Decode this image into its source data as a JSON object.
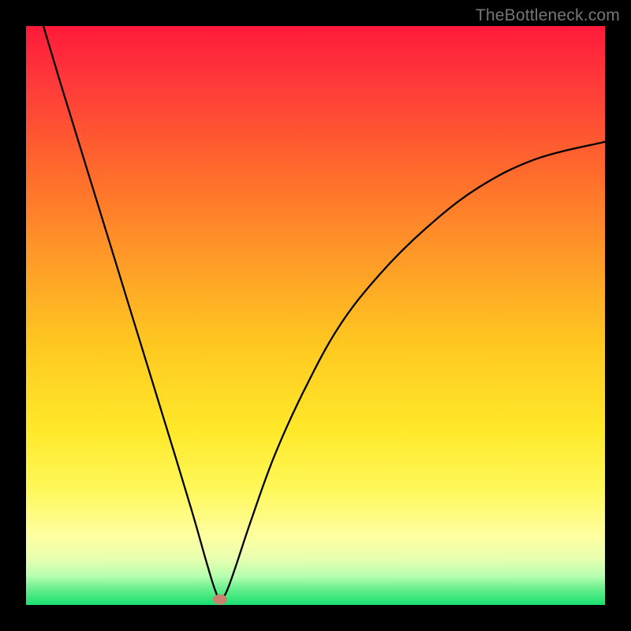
{
  "watermark": {
    "text": "TheBottleneck.com"
  },
  "chart_data": {
    "type": "line",
    "title": "",
    "xlabel": "",
    "ylabel": "",
    "xlim": [
      0,
      100
    ],
    "ylim": [
      0,
      100
    ],
    "grid": false,
    "series": [
      {
        "name": "bottleneck-curve",
        "x": [
          3,
          6,
          10,
          14,
          18,
          22,
          26,
          29,
          31,
          32.5,
          33.5,
          34.5,
          36,
          39,
          43,
          48,
          54,
          61,
          69,
          78,
          88,
          100
        ],
        "y": [
          100,
          90,
          77,
          64,
          51,
          38,
          25,
          15,
          8,
          3,
          1,
          2,
          6,
          15,
          26,
          37,
          48,
          57,
          65,
          72,
          77,
          80
        ]
      }
    ],
    "marker": {
      "x": 33.5,
      "y": 1,
      "color": "#c9836f"
    },
    "background_gradient": {
      "stops": [
        {
          "pos": 0,
          "color": "#ff1a3a"
        },
        {
          "pos": 10,
          "color": "#ff3a3a"
        },
        {
          "pos": 25,
          "color": "#ff6a2c"
        },
        {
          "pos": 40,
          "color": "#ff9a28"
        },
        {
          "pos": 55,
          "color": "#ffc820"
        },
        {
          "pos": 70,
          "color": "#ffe92a"
        },
        {
          "pos": 80,
          "color": "#fff85a"
        },
        {
          "pos": 88,
          "color": "#ffffa0"
        },
        {
          "pos": 92,
          "color": "#e8ffb0"
        },
        {
          "pos": 95,
          "color": "#b8ffb0"
        },
        {
          "pos": 97,
          "color": "#70f090"
        },
        {
          "pos": 100,
          "color": "#18e070"
        }
      ]
    }
  }
}
